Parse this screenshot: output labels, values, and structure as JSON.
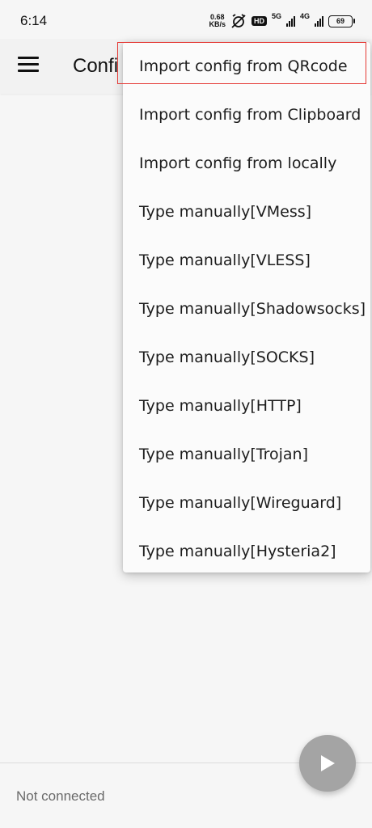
{
  "status_bar": {
    "time": "6:14",
    "speed_value": "0.68",
    "speed_unit": "KB/s",
    "hd": "HD",
    "net_5g": "5G",
    "net_4g": "4G",
    "battery": "69"
  },
  "app_bar": {
    "title": "Confi",
    "menu_icon": "hamburger-menu-icon"
  },
  "dropdown": {
    "items": [
      {
        "label": "Import config from QRcode"
      },
      {
        "label": "Import config from Clipboard"
      },
      {
        "label": "Import config from locally"
      },
      {
        "label": "Type manually[VMess]"
      },
      {
        "label": "Type manually[VLESS]"
      },
      {
        "label": "Type manually[Shadowsocks]"
      },
      {
        "label": "Type manually[SOCKS]"
      },
      {
        "label": "Type manually[HTTP]"
      },
      {
        "label": "Type manually[Trojan]"
      },
      {
        "label": "Type manually[Wireguard]"
      },
      {
        "label": "Type manually[Hysteria2]"
      }
    ]
  },
  "footer": {
    "connection_status": "Not connected",
    "fab_icon": "play-icon"
  },
  "colors": {
    "highlight": "#e53935",
    "fab": "#a4a4a4",
    "background": "#f6f6f6"
  }
}
